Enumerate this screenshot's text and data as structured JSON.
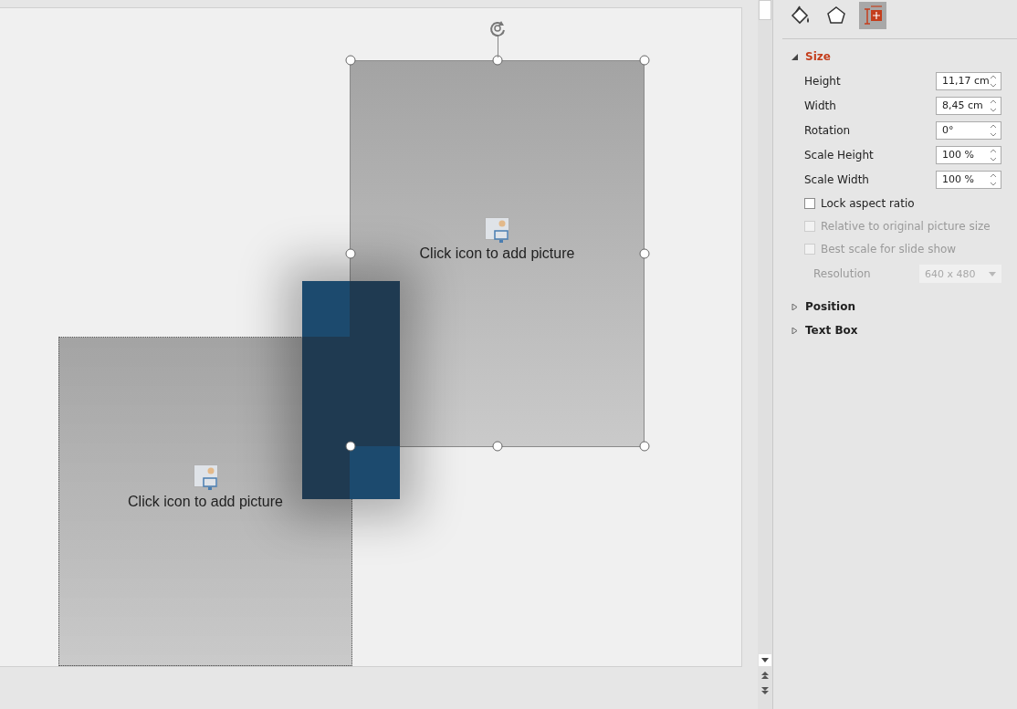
{
  "slide": {
    "placeholders": [
      {
        "text": "Click icon to add picture",
        "selected": true
      },
      {
        "text": "Click icon to add picture",
        "selected": false
      }
    ]
  },
  "panel": {
    "tabs": [
      {
        "kind": "fill",
        "selected": false
      },
      {
        "kind": "effects",
        "selected": false
      },
      {
        "kind": "size",
        "selected": true
      }
    ],
    "sections": [
      {
        "title": "Size",
        "expanded": true,
        "items": [
          {
            "kind": "spinner",
            "label": "Height",
            "value": "11,17 cm"
          },
          {
            "kind": "spinner",
            "label": "Width",
            "value": "8,45 cm"
          },
          {
            "kind": "spinner",
            "label": "Rotation",
            "value": "0°"
          },
          {
            "kind": "spinner",
            "label": "Scale Height",
            "value": "100 %"
          },
          {
            "kind": "spinner",
            "label": "Scale Width",
            "value": "100 %"
          },
          {
            "kind": "checkbox",
            "label": "Lock aspect ratio",
            "checked": false,
            "disabled": false
          },
          {
            "kind": "checkbox",
            "label": "Relative to original picture size",
            "checked": false,
            "disabled": true
          },
          {
            "kind": "checkbox",
            "label": "Best scale for slide show",
            "checked": false,
            "disabled": true
          },
          {
            "kind": "dropdown",
            "label": "Resolution",
            "value": "640 x 480",
            "disabled": true
          }
        ]
      },
      {
        "title": "Position",
        "expanded": false
      },
      {
        "title": "Text Box",
        "expanded": false
      }
    ]
  }
}
